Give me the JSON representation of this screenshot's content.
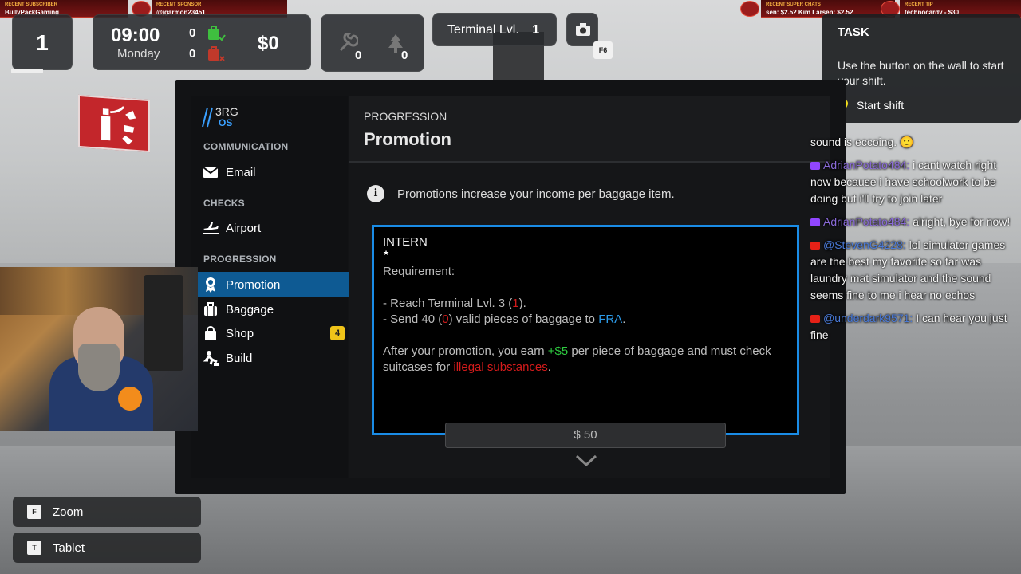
{
  "banner": {
    "recent_subscriber_label": "RECENT SUBSCRIBER",
    "recent_subscriber": "BullyPackGaming",
    "recent_sponsor_label": "RECENT SPONSOR",
    "recent_sponsor": "@jgarmon23451",
    "recent_super_chats_label": "RECENT SUPER CHATS",
    "recent_super_chats": "sen: $2.52   Kim Larsen: $2.52",
    "recent_tip_label": "RECENT TIP",
    "recent_tip": "technocardy - $30"
  },
  "hud": {
    "day_number": "1",
    "time": "09:00",
    "weekday": "Monday",
    "bags_ok_count": "0",
    "bags_bad_count": "0",
    "money": "$0",
    "tool_count": "0",
    "tree_count": "0",
    "terminal_label": "Terminal Lvl.",
    "terminal_level": "1",
    "screenshot_key": "F6"
  },
  "task": {
    "heading": "TASK",
    "description": "Use the button on the wall to start your shift.",
    "action": "Start shift"
  },
  "tablet": {
    "logo_line1": "3RG",
    "logo_line2": "OS",
    "sections": {
      "communication": "COMMUNICATION",
      "checks": "CHECKS",
      "progression": "PROGRESSION"
    },
    "nav": {
      "email": "Email",
      "airport": "Airport",
      "promotion": "Promotion",
      "baggage": "Baggage",
      "shop": "Shop",
      "shop_badge": "4",
      "build": "Build"
    },
    "header": {
      "category": "PROGRESSION",
      "title": "Promotion"
    },
    "info_text": "Promotions increase your income per baggage item.",
    "card": {
      "role": "INTERN",
      "star": "★",
      "requirement_label": "Requirement:",
      "req1_prefix": "- Reach Terminal Lvl. 3 (",
      "req1_value": "1",
      "req1_suffix": ").",
      "req2_prefix": "- Send 40 (",
      "req2_value": "0",
      "req2_middle": ") valid pieces of baggage to ",
      "req2_dest": "FRA",
      "req2_suffix": ".",
      "after_prefix": "After your promotion, you earn ",
      "after_amount": "+$5",
      "after_middle": " per piece of baggage and must check suitcases for ",
      "after_red": "illegal substances",
      "after_suffix": "."
    },
    "price_button": "$ 50"
  },
  "chat": {
    "msg0_text": "sound is eccoing. 🙂",
    "msg1_user": "AdrianPotato484:",
    "msg1_text": "i cant watch right now because i have schoolwork to be doing but i'll try to join later",
    "msg2_user": "AdrianPotato484:",
    "msg2_text": "alright, bye for now!",
    "msg3_user": "@StevenG4228:",
    "msg3_text": "lol simulator games are the best my favorite so far was laundry mat simulator and the sound seems fine to me i hear no echos",
    "msg4_user": "@underdark9571:",
    "msg4_text": "I can hear you just fine"
  },
  "controls": {
    "zoom_key": "F",
    "zoom_label": "Zoom",
    "tablet_key": "T",
    "tablet_label": "Tablet"
  },
  "colors": {
    "accent": "#1a8ce6",
    "active_nav": "#0e5a93",
    "green": "#2ecc40",
    "red": "#d41b1b",
    "badge_yellow": "#f0c419"
  }
}
